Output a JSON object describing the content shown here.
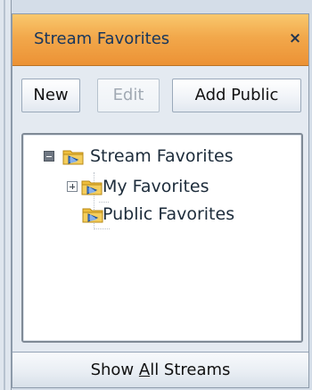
{
  "panel": {
    "title": "Stream Favorites",
    "close_icon": "close-icon",
    "close_glyph": "×"
  },
  "toolbar": {
    "new_label": "New",
    "edit_label": "Edit",
    "add_public_label": "Add Public"
  },
  "tree": {
    "root": {
      "label": "Stream Favorites",
      "expanded": true,
      "icon": "stream-folder-icon",
      "children": [
        {
          "label": "My Favorites",
          "expanded": false,
          "icon": "stream-folder-icon"
        },
        {
          "label": "Public Favorites",
          "expanded": false,
          "icon": "stream-folder-icon"
        }
      ]
    }
  },
  "footer": {
    "show_all_prefix": "Show ",
    "show_all_mnemonic": "A",
    "show_all_suffix": "ll Streams"
  }
}
